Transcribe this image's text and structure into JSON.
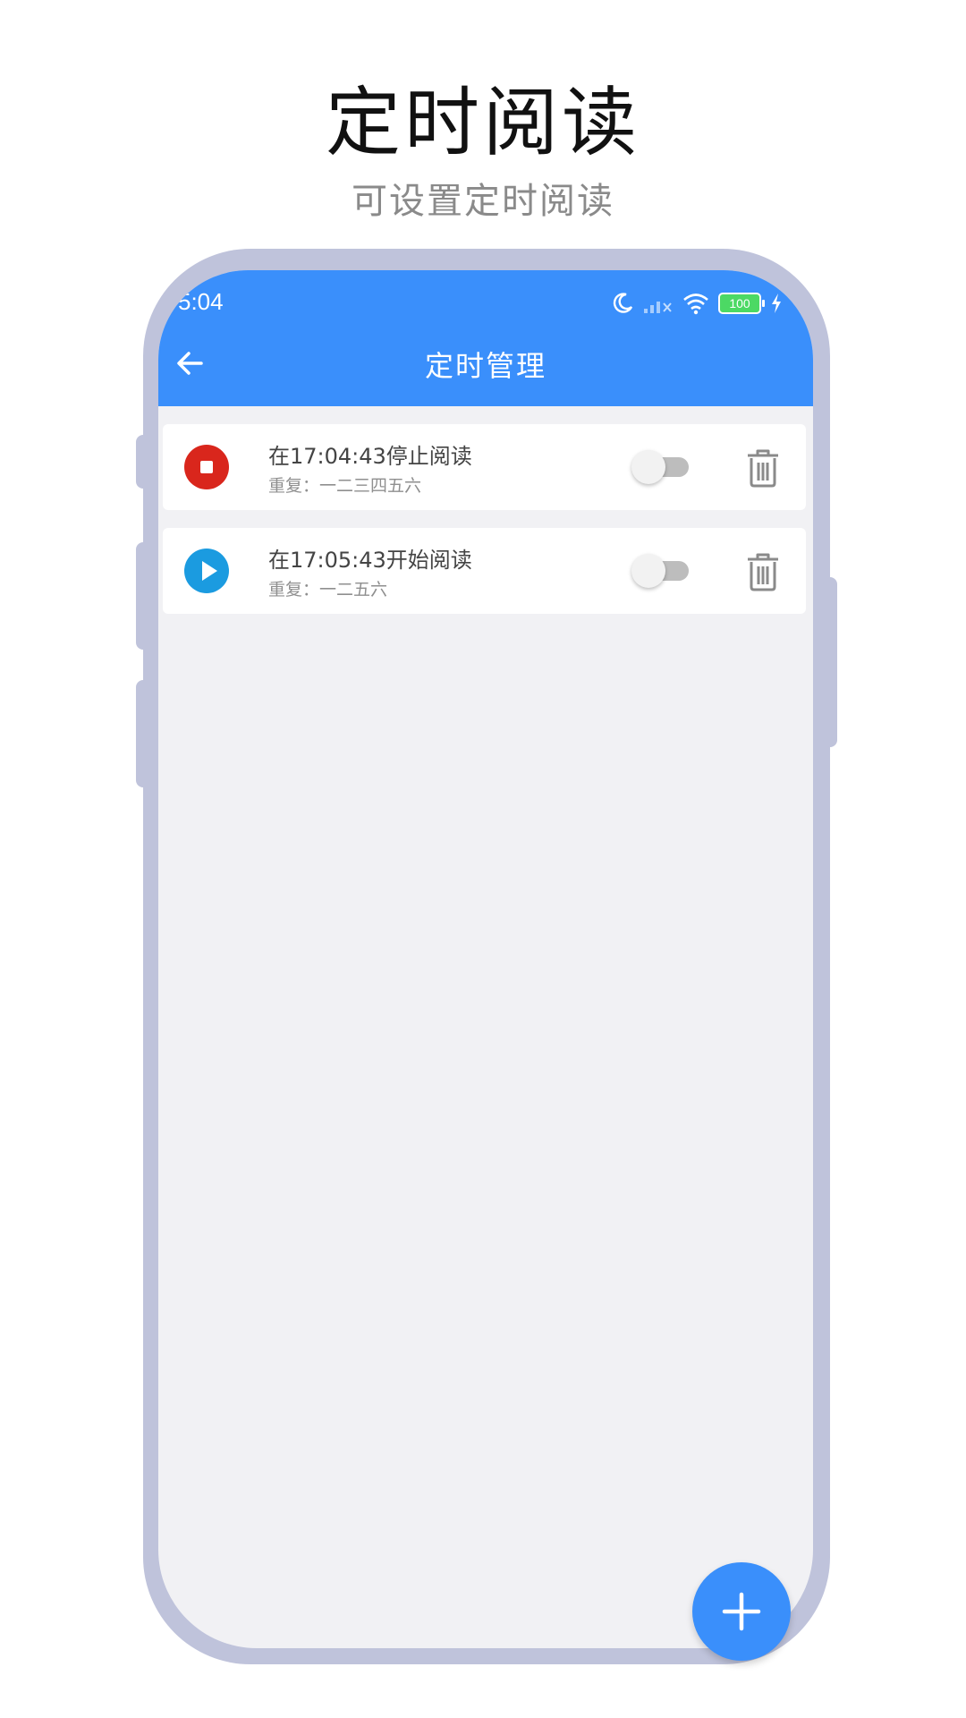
{
  "promo": {
    "title": "定时阅读",
    "subtitle": "可设置定时阅读"
  },
  "status_bar": {
    "time": "5:04",
    "battery": "100",
    "icons": [
      "moon-icon",
      "signal-icon",
      "wifi-icon",
      "battery-icon",
      "charging-icon"
    ]
  },
  "header": {
    "title": "定时管理",
    "back_icon": "arrow-left-icon"
  },
  "tasks": [
    {
      "label": "在17:04:43停止阅读",
      "repeat": "重复：一二三四五六",
      "action": "stop",
      "enabled": false
    },
    {
      "label": "在17:05:43开始阅读",
      "repeat": "重复：一二五六",
      "action": "start",
      "enabled": false
    }
  ],
  "fab": {
    "icon": "plus-icon"
  },
  "colors": {
    "primary": "#3a8ffb",
    "stop": "#d9261c",
    "start": "#1b9be0",
    "frame": "#bfc3db",
    "background": "#f1f1f4"
  }
}
